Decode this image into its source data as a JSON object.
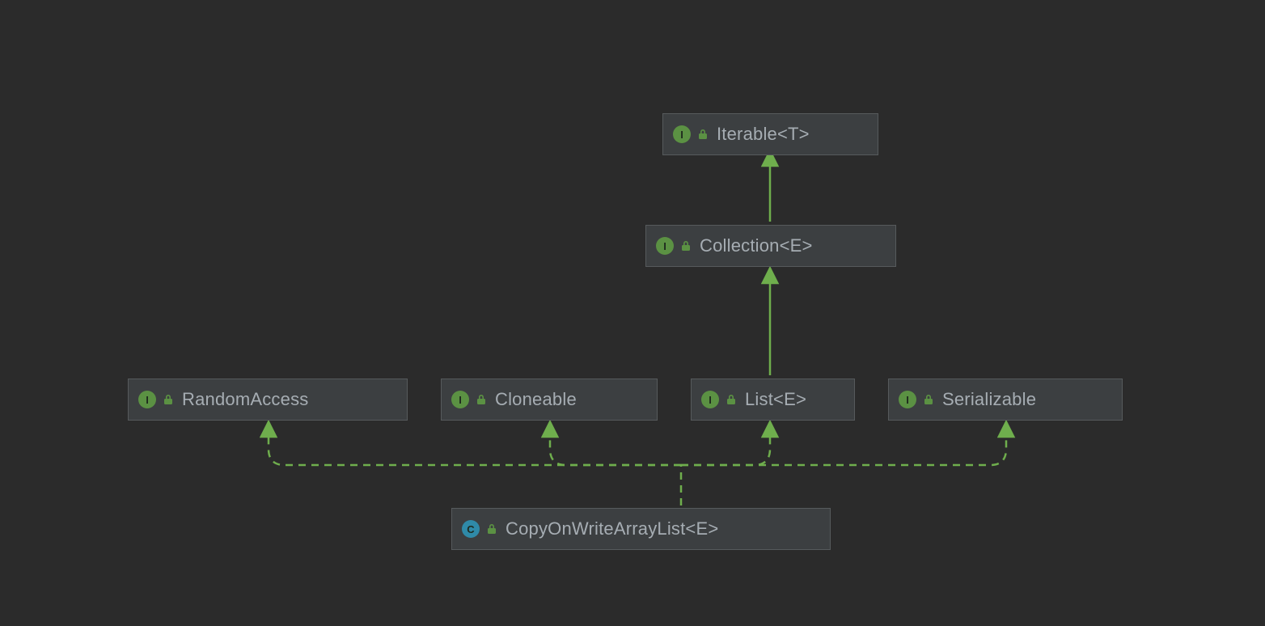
{
  "colors": {
    "bg": "#2b2b2b",
    "nodeBg": "#3c3f41",
    "nodeBorder": "#565a5c",
    "text": "#a6adb3",
    "interfaceBadge": "#5b9143",
    "classBadge": "#2f8aa8",
    "lock": "#5b9143",
    "connector": "#6fae4d"
  },
  "nodes": {
    "iterable": {
      "kind": "interface",
      "label": "Iterable<T>"
    },
    "collection": {
      "kind": "interface",
      "label": "Collection<E>"
    },
    "randomaccess": {
      "kind": "interface",
      "label": "RandomAccess"
    },
    "cloneable": {
      "kind": "interface",
      "label": "Cloneable"
    },
    "list": {
      "kind": "interface",
      "label": "List<E>"
    },
    "serializable": {
      "kind": "interface",
      "label": "Serializable"
    },
    "cowal": {
      "kind": "class",
      "label": "CopyOnWriteArrayList<E>"
    }
  },
  "badgeLetters": {
    "interface": "I",
    "class": "C"
  },
  "edges": [
    {
      "from": "collection",
      "to": "iterable",
      "style": "solid"
    },
    {
      "from": "list",
      "to": "collection",
      "style": "solid"
    },
    {
      "from": "cowal",
      "to": "randomaccess",
      "style": "dashed"
    },
    {
      "from": "cowal",
      "to": "cloneable",
      "style": "dashed"
    },
    {
      "from": "cowal",
      "to": "list",
      "style": "dashed"
    },
    {
      "from": "cowal",
      "to": "serializable",
      "style": "dashed"
    }
  ]
}
